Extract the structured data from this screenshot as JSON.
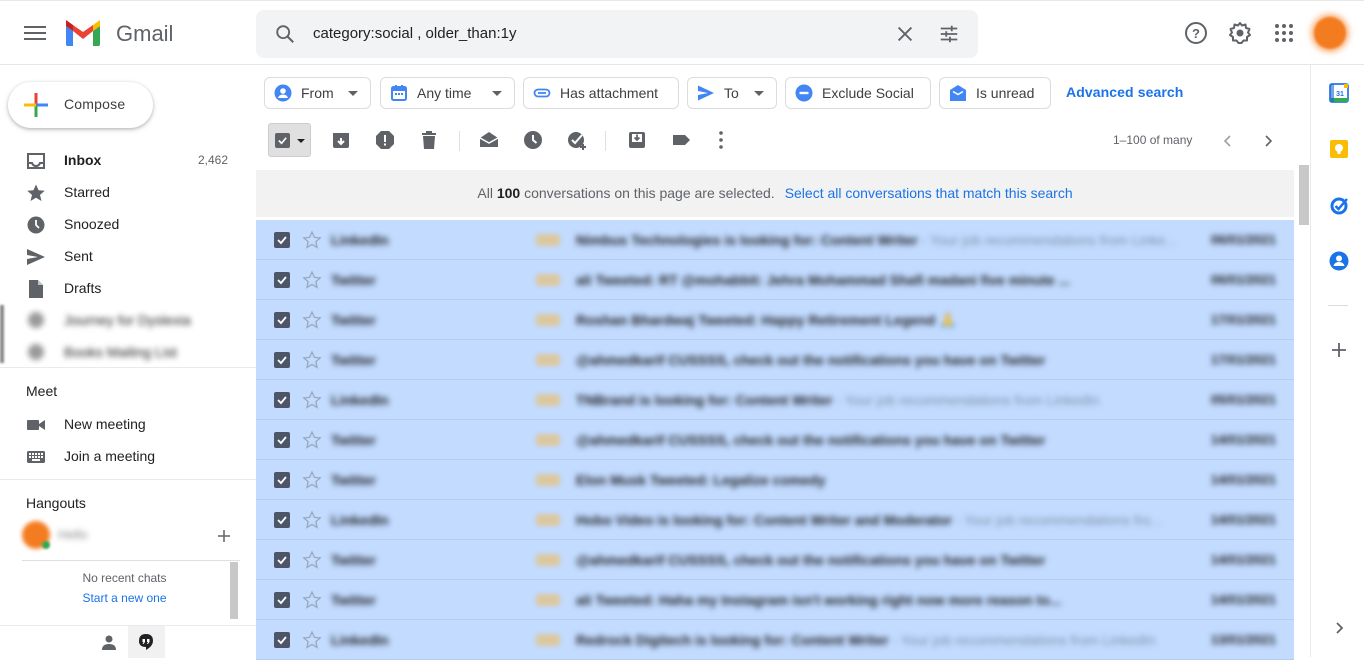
{
  "app": {
    "name": "Gmail"
  },
  "search": {
    "query": "category:social , older_than:1y"
  },
  "header_icons": [
    "help-icon",
    "settings-icon",
    "apps-icon",
    "account-avatar"
  ],
  "compose": {
    "label": "Compose"
  },
  "sidebar": {
    "items": [
      {
        "label": "Inbox",
        "count": "2,462",
        "icon": "inbox-icon",
        "bold": true
      },
      {
        "label": "Starred",
        "icon": "star-icon"
      },
      {
        "label": "Snoozed",
        "icon": "clock-icon"
      },
      {
        "label": "Sent",
        "icon": "send-icon"
      },
      {
        "label": "Drafts",
        "icon": "draft-icon"
      },
      {
        "label": "Journey for Dyslexia",
        "icon": "label-icon",
        "blurred": true
      },
      {
        "label": "Books Mailing List",
        "icon": "label-icon",
        "blurred": true
      }
    ],
    "meet": {
      "title": "Meet",
      "items": [
        {
          "label": "New meeting",
          "icon": "videocam-icon"
        },
        {
          "label": "Join a meeting",
          "icon": "keyboard-icon"
        }
      ]
    },
    "hangouts": {
      "title": "Hangouts",
      "user": "Hello",
      "empty_text": "No recent chats",
      "start_link": "Start a new one"
    }
  },
  "filters": {
    "chips": [
      {
        "label": "From",
        "icon": "person-icon",
        "dropdown": true
      },
      {
        "label": "Any time",
        "icon": "calendar-icon",
        "dropdown": true
      },
      {
        "label": "Has attachment",
        "icon": "attachment-icon",
        "dropdown": false
      },
      {
        "label": "To",
        "icon": "send-icon",
        "dropdown": true
      },
      {
        "label": "Exclude Social",
        "icon": "minus-circle-icon",
        "dropdown": false
      },
      {
        "label": "Is unread",
        "icon": "unread-icon",
        "dropdown": false
      }
    ],
    "advanced_search": "Advanced search"
  },
  "toolbar": {
    "pager": "1–100 of many"
  },
  "banner": {
    "prefix": "All ",
    "count": "100",
    "suffix": " conversations on this page are selected.",
    "link": "Select all conversations that match this search"
  },
  "emails": [
    {
      "sender": "LinkedIn",
      "subject": "Nimbus Technologies is looking for: Content Writer",
      "snippet": " - Your job recommendations from Linke...",
      "date": "06/01/2021"
    },
    {
      "sender": "Twitter",
      "subject": "ali Tweeted: RT @mohabbit: Jehra Mohammad Shafi madani five minute ...",
      "snippet": "",
      "date": "06/01/2021"
    },
    {
      "sender": "Twitter",
      "subject": "Roshan Bhardwaj Tweeted: Happy Retirement Legend 🙏",
      "snippet": "",
      "date": "17/01/2021"
    },
    {
      "sender": "Twitter",
      "subject": "@ahmedkarif CUSSSS, check out the notifications you have on Twitter",
      "snippet": "",
      "date": "17/01/2021"
    },
    {
      "sender": "LinkedIn",
      "subject": "TNBrand is looking for: Content Writer",
      "snippet": " - Your job recommendations from LinkedIn",
      "date": "05/01/2021"
    },
    {
      "sender": "Twitter",
      "subject": "@ahmedkarif CUSSSS, check out the notifications you have on Twitter",
      "snippet": "",
      "date": "14/01/2021"
    },
    {
      "sender": "Twitter",
      "subject": "Elon Musk Tweeted: Legalize comedy",
      "snippet": "",
      "date": "14/01/2021"
    },
    {
      "sender": "LinkedIn",
      "subject": "Hobo Video is looking for: Content Writer and Moderator",
      "snippet": " - Your job recommendations fro...",
      "date": "14/01/2021"
    },
    {
      "sender": "Twitter",
      "subject": "@ahmedkarif CUSSSS, check out the notifications you have on Twitter",
      "snippet": "",
      "date": "14/01/2021"
    },
    {
      "sender": "Twitter",
      "subject": "ali Tweeted: Haha my Instagram isn't working right now more reason to...",
      "snippet": "",
      "date": "14/01/2021"
    },
    {
      "sender": "LinkedIn",
      "subject": "Redrock Digitech is looking for: Content Writer",
      "snippet": " - Your job recommendations from LinkedIn",
      "date": "13/01/2021"
    }
  ],
  "right_rail": [
    "calendar-icon",
    "keep-icon",
    "tasks-icon",
    "contacts-icon",
    "add-icon"
  ]
}
